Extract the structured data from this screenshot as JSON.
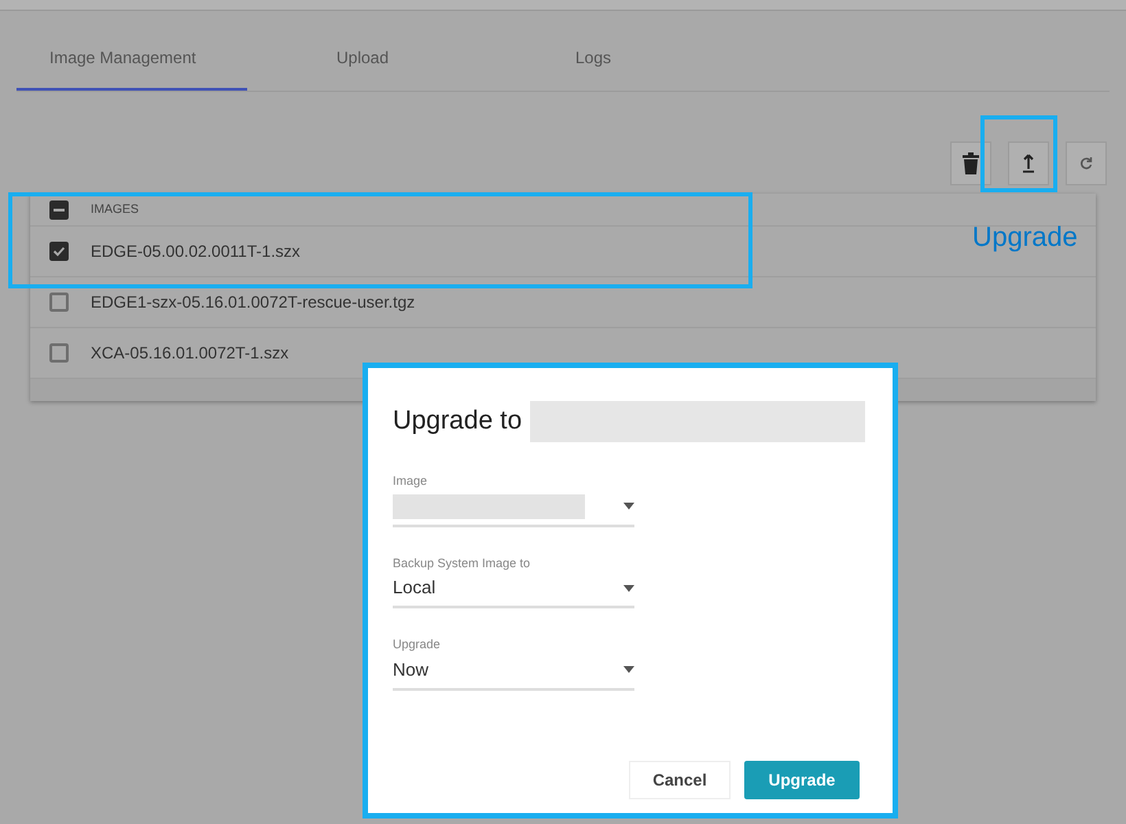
{
  "tabs": [
    {
      "label": "Image Management",
      "selected": true
    },
    {
      "label": "Upload",
      "selected": false
    },
    {
      "label": "Logs",
      "selected": false
    }
  ],
  "table": {
    "header": "IMAGES",
    "header_indeterminate": true,
    "rows": [
      {
        "name": "EDGE-05.00.02.0011T-1.szx",
        "checked": true
      },
      {
        "name": "EDGE1-szx-05.16.01.0072T-rescue-user.tgz",
        "checked": false
      },
      {
        "name": "XCA-05.16.01.0072T-1.szx",
        "checked": false
      }
    ]
  },
  "annotation": {
    "label": "Upgrade"
  },
  "dialog": {
    "title": "Upgrade to",
    "fields": [
      {
        "label": "Image",
        "redacted": true
      },
      {
        "label": "Backup System Image to",
        "value": "Local",
        "redacted": false
      },
      {
        "label": "Upgrade",
        "value": "Now",
        "redacted": false
      }
    ],
    "buttons": [
      {
        "label": "Cancel",
        "kind": "secondary"
      },
      {
        "label": "Upgrade",
        "kind": "primary"
      }
    ]
  }
}
